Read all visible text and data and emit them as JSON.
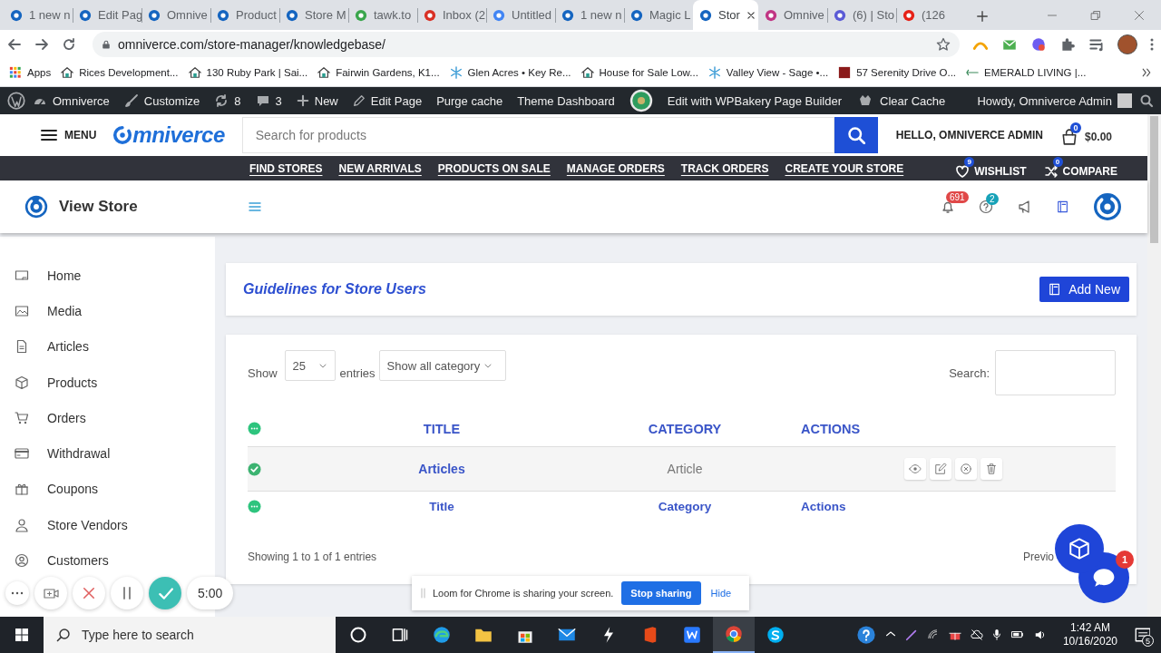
{
  "browser": {
    "tabs": [
      {
        "title": "1 new n",
        "selected": false
      },
      {
        "title": "Edit Pag",
        "selected": false
      },
      {
        "title": "Omnive",
        "selected": false
      },
      {
        "title": "Product",
        "selected": false
      },
      {
        "title": "Store M",
        "selected": false
      },
      {
        "title": "tawk.to",
        "selected": false
      },
      {
        "title": "Inbox (2",
        "selected": false
      },
      {
        "title": "Untitled",
        "selected": false
      },
      {
        "title": "1 new n",
        "selected": false
      },
      {
        "title": "Magic L",
        "selected": false
      },
      {
        "title": "Stor",
        "selected": true
      },
      {
        "title": "Omnive",
        "selected": false
      },
      {
        "title": "(6) | Sto",
        "selected": false
      },
      {
        "title": "(126",
        "selected": false
      }
    ],
    "url": "omniverce.com/store-manager/knowledgebase/",
    "apps_label": "Apps",
    "bookmarks": [
      "Rices Development...",
      "130 Ruby Park | Sai...",
      "Fairwin Gardens, K1...",
      "Glen Acres • Key Re...",
      "House for Sale Low...",
      "Valley View - Sage •...",
      "57 Serenity Drive O...",
      "EMERALD LIVING |..."
    ]
  },
  "admin_bar": {
    "items": [
      "Omniverce",
      "Customize",
      "8",
      "3",
      "New",
      "Edit Page",
      "Purge cache",
      "Theme Dashboard",
      "Edit with WPBakery Page Builder",
      "Clear Cache"
    ],
    "greeting": "Howdy, Omniverce Admin"
  },
  "header": {
    "menu": "MENU",
    "logo": "mniverce",
    "search_placeholder": "Search for products",
    "account": "HELLO, OMNIVERCE ADMIN",
    "cart_count": "0",
    "cart_total": "$0.00"
  },
  "nav": {
    "links": [
      "FIND STORES",
      "NEW ARRIVALS",
      "PRODUCTS ON SALE",
      "MANAGE ORDERS",
      "TRACK ORDERS",
      "CREATE YOUR STORE"
    ],
    "wishlist": {
      "label": "WISHLIST",
      "count": "9"
    },
    "compare": {
      "label": "COMPARE",
      "count": "0"
    }
  },
  "store": {
    "title": "View Store",
    "notifications": "691",
    "help": "2"
  },
  "sidebar": {
    "items": [
      "Home",
      "Media",
      "Articles",
      "Products",
      "Orders",
      "Withdrawal",
      "Coupons",
      "Store Vendors",
      "Customers"
    ]
  },
  "page": {
    "title": "Guidelines for Store Users",
    "add_button": "Add New"
  },
  "table": {
    "show_label": "Show",
    "page_size": "25",
    "entries_label": "entries",
    "category_filter": "Show all category",
    "search_label": "Search:",
    "columns": [
      "TITLE",
      "CATEGORY",
      "ACTIONS"
    ],
    "rows": [
      {
        "title": "Articles",
        "category": "Article"
      }
    ],
    "footer": [
      "Title",
      "Category",
      "Actions"
    ],
    "info": "Showing 1 to 1 of 1 entries",
    "pager": "Previo"
  },
  "loom": {
    "timer": "5:00",
    "message": "Loom for Chrome is sharing your screen.",
    "stop": "Stop sharing",
    "hide": "Hide"
  },
  "chat": {
    "badge": "1"
  },
  "taskbar": {
    "search_placeholder": "Type here to search",
    "time": "1:42 AM",
    "date": "10/16/2020",
    "notifications": "5"
  }
}
